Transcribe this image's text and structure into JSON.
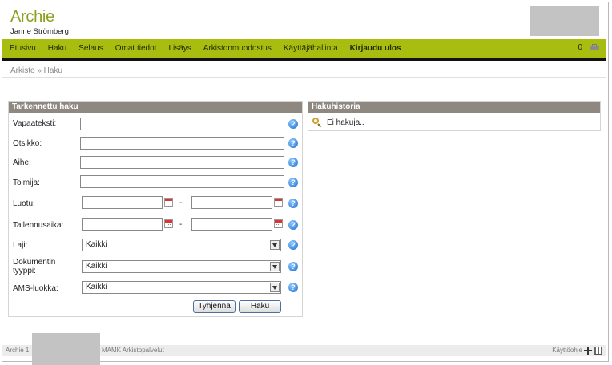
{
  "header": {
    "title": "Archie",
    "user": "Janne Strömberg"
  },
  "nav": {
    "items": [
      "Etusivu",
      "Haku",
      "Selaus",
      "Omat tiedot",
      "Lisäys",
      "Arkistonmuodostus",
      "Käyttäjähallinta"
    ],
    "logout": "Kirjaudu ulos",
    "cart_count": "0"
  },
  "breadcrumb": "Arkisto » Haku",
  "search": {
    "title": "Tarkennettu haku",
    "labels": {
      "vapaateksti": "Vapaateksti:",
      "otsikko": "Otsikko:",
      "aihe": "Aihe:",
      "toimija": "Toimija:",
      "luotu": "Luotu:",
      "tallennusaika": "Tallennusaika:",
      "laji": "Laji:",
      "dokumentin_tyyppi": "Dokumentin tyyppi:",
      "ams_luokka": "AMS-luokka:"
    },
    "values": {
      "vapaateksti": "",
      "otsikko": "",
      "aihe": "",
      "toimija": "",
      "luotu_from": "",
      "luotu_to": "",
      "tallennusaika_from": "",
      "tallennusaika_to": ""
    },
    "selects": {
      "laji": "Kaikki",
      "dokumentin_tyyppi": "Kaikki",
      "ams_luokka": "Kaikki"
    },
    "range_separator": "-",
    "help": "?",
    "clear_button": "Tyhjennä",
    "search_button": "Haku"
  },
  "history": {
    "title": "Hakuhistoria",
    "empty_text": "Ei hakuja.."
  },
  "footer": {
    "left": "Archie 1",
    "middle": "MAMK Arkistopalvelut",
    "help_link": "Käyttöohje"
  },
  "colors": {
    "nav_bg": "#a9bd10",
    "title_green": "#8aa01e",
    "panel_header": "#8e8880"
  }
}
